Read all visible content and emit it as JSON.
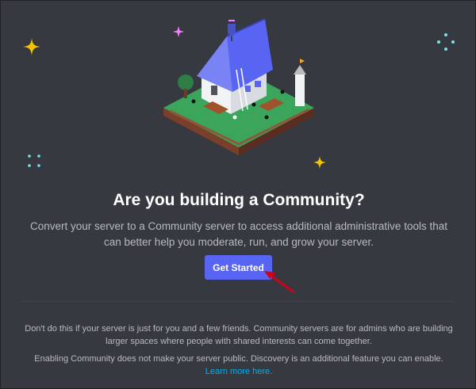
{
  "hero": {
    "title": "Are you building a Community?",
    "description": "Convert your server to a Community server to access additional administrative tools that can better help you moderate, run, and grow your server."
  },
  "cta": {
    "label": "Get Started"
  },
  "notes": {
    "paragraph1": "Don't do this if your server is just for you and a few friends. Community servers are for admins who are building larger spaces where people with shared interests can come together.",
    "paragraph2_text": "Enabling Community does not make your server public. Discovery is an additional feature you can enable. ",
    "paragraph2_link": "Learn more here."
  },
  "colors": {
    "background": "#36393f",
    "accent": "#5865f2",
    "link": "#00aff4",
    "text_muted": "#b9bbbe",
    "arrow": "#d0021b"
  },
  "icons": [
    "sparkle-yellow-icon",
    "sparkle-pink-icon",
    "sparkle-cyan-icon",
    "community-house-illustration",
    "red-arrow-icon"
  ]
}
